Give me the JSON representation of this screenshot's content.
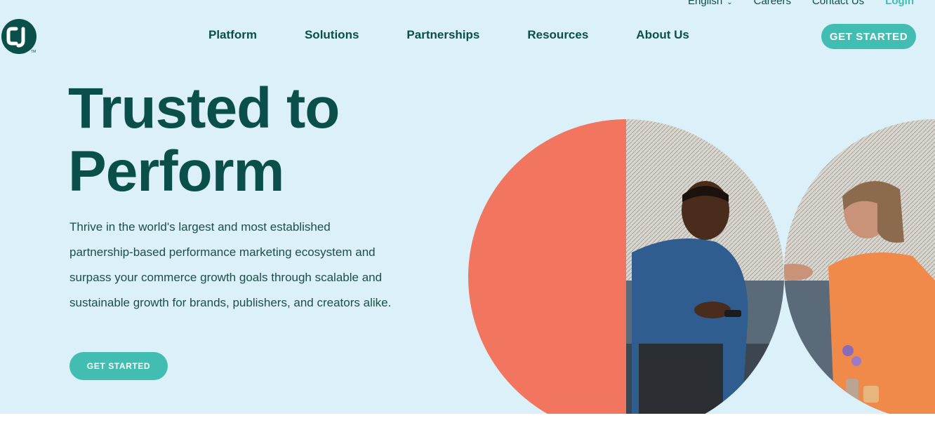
{
  "header": {
    "utility_links": {
      "language": "English",
      "careers": "Careers",
      "contact": "Contact Us",
      "login": "Login"
    },
    "logo_text": "CJ",
    "nav": [
      "Platform",
      "Solutions",
      "Partnerships",
      "Resources",
      "About Us"
    ],
    "cta": "GET STARTED"
  },
  "hero": {
    "headline_line1": "Trusted to",
    "headline_line2": "Perform",
    "body": "Thrive in the world's largest and most established partnership-based performance marketing ecosystem and surpass your commerce growth goals through scalable and sustainable growth for brands, publishers, and creators alike.",
    "cta": "GET STARTED"
  },
  "colors": {
    "background": "#dbf0f8",
    "primary_text": "#0b4f4a",
    "accent": "#41bdb2",
    "coral": "#f1755f"
  },
  "icons": {
    "logo": "cj-logo-icon",
    "language_dropdown": "chevron-down-icon"
  }
}
